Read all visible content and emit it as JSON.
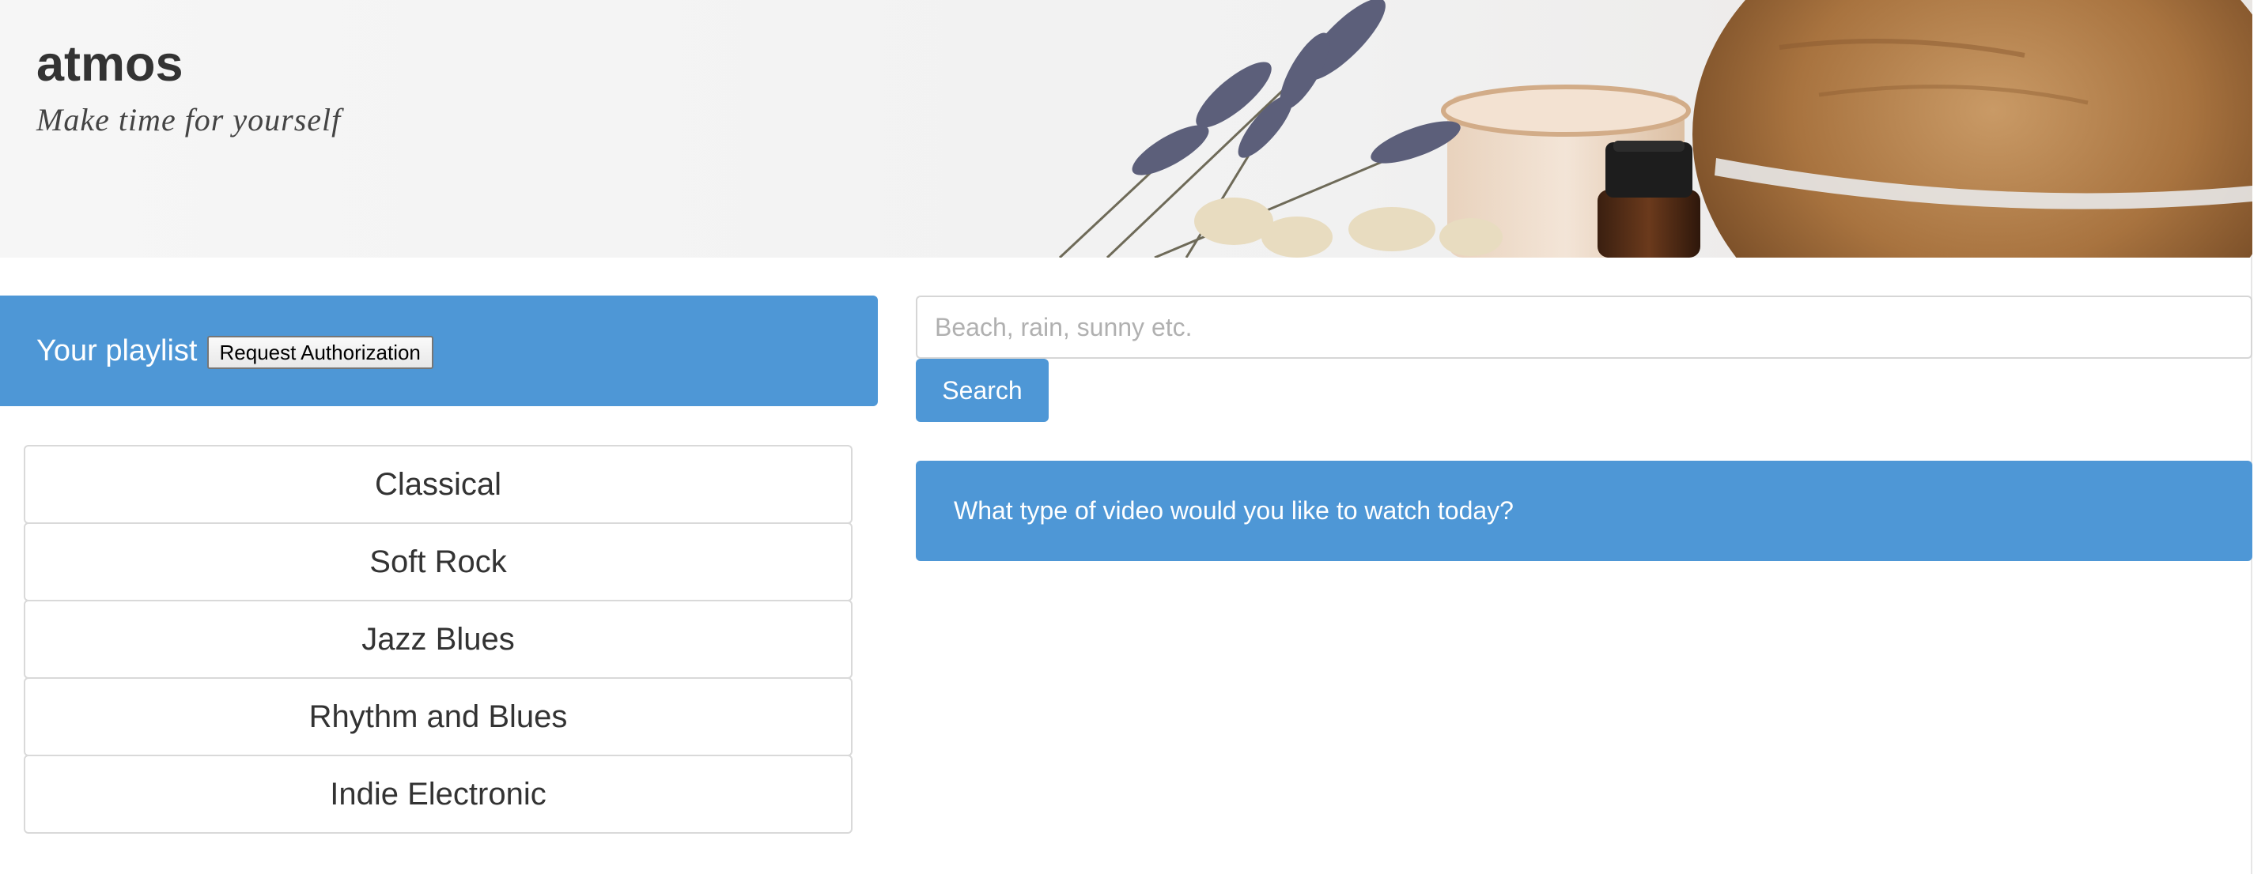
{
  "header": {
    "brand": "atmos",
    "tagline": "Make time for yourself"
  },
  "playlist": {
    "title": "Your playlist",
    "auth_button_label": "Request Authorization",
    "genres": [
      "Classical",
      "Soft Rock",
      "Jazz Blues",
      "Rhythm and Blues",
      "Indie Electronic"
    ]
  },
  "search": {
    "placeholder": "Beach, rain, sunny etc.",
    "value": "",
    "button_label": "Search"
  },
  "prompt": {
    "text": "What type of video would you like to watch today?"
  },
  "colors": {
    "accent": "#4e97d6",
    "text": "#333333",
    "border": "#d9d9d9"
  },
  "icons": {
    "hero_image": "aromatherapy-diffuser-lavender-image"
  }
}
